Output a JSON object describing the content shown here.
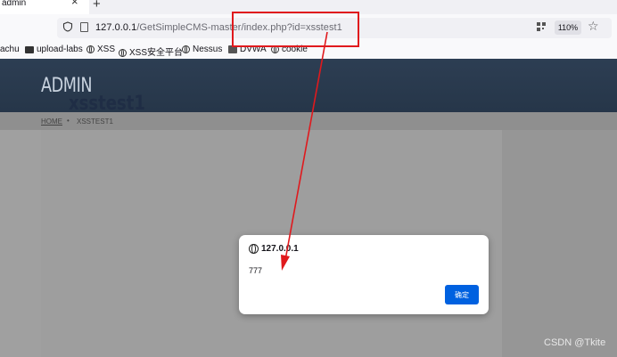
{
  "browser": {
    "tab": {
      "title": "admin",
      "close_symbol": "×"
    },
    "new_tab_symbol": "+",
    "url": {
      "host": "127.0.0.1",
      "path": "/GetSimpleCMS-master/index.php?id=xsstest1"
    },
    "zoom": "110%",
    "star_symbol": "☆",
    "bookmarks": [
      {
        "label": "achu",
        "icon": "none"
      },
      {
        "label": "upload-labs",
        "icon": "folder-icon"
      },
      {
        "label": "XSS",
        "icon": "globe-icon"
      },
      {
        "label": "XSS安全平台",
        "icon": "xss-platform-icon"
      },
      {
        "label": "Nessus",
        "icon": "globe-icon"
      },
      {
        "label": "DVWA",
        "icon": "dvwa-icon"
      },
      {
        "label": "cookie",
        "icon": "globe-icon"
      }
    ]
  },
  "site": {
    "brand": "ADMIN",
    "breadcrumb": {
      "home": "HOME",
      "separator": "•",
      "current": "XSSTEST1"
    },
    "page_title": "xsstest1"
  },
  "alert": {
    "origin": "127.0.0.1",
    "message": "777",
    "ok_label": "确定"
  },
  "watermark": "CSDN @Tkite",
  "colors": {
    "annotation_red": "#e0191d",
    "header_blue": "#2d3e53",
    "ok_button_blue": "#0061e0"
  }
}
